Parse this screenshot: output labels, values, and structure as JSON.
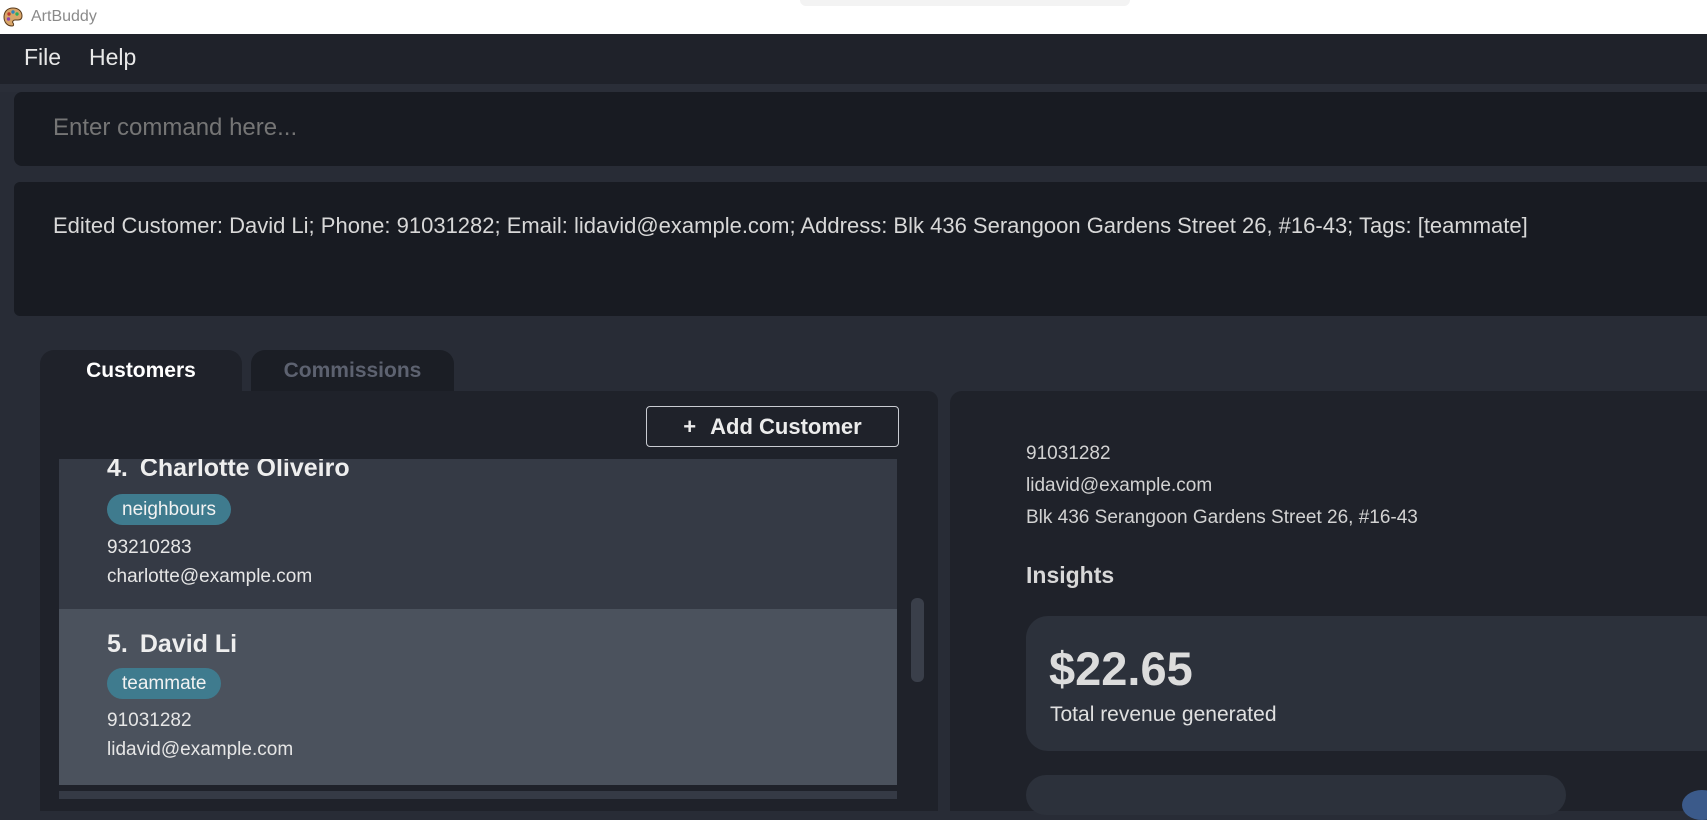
{
  "window": {
    "title": "ArtBuddy",
    "icon": "palette-icon"
  },
  "menu": {
    "file": "File",
    "help": "Help"
  },
  "command": {
    "placeholder": "Enter command here..."
  },
  "result": {
    "text": "Edited Customer: David Li; Phone: 91031282; Email: lidavid@example.com; Address: Blk 436 Serangoon Gardens Street 26, #16-43; Tags: [teammate]"
  },
  "tabs": {
    "customers": "Customers",
    "commissions": "Commissions"
  },
  "add_customer": {
    "icon": "+",
    "label": "Add Customer"
  },
  "customers": [
    {
      "index": "4.",
      "name": "Charlotte Oliveiro",
      "tag": "neighbours",
      "phone": "93210283",
      "email": "charlotte@example.com"
    },
    {
      "index": "5.",
      "name": "David Li",
      "tag": "teammate",
      "phone": "91031282",
      "email": "lidavid@example.com"
    }
  ],
  "detail": {
    "phone": "91031282",
    "email": "lidavid@example.com",
    "address": "Blk 436 Serangoon Gardens Street 26, #16-43",
    "insights_heading": "Insights",
    "revenue_value": "$22.65",
    "revenue_label": "Total revenue generated"
  },
  "colors": {
    "background": "#282c36",
    "panel": "#1f222a",
    "tag": "#3f7b8e",
    "selected_card": "#4b525d"
  }
}
